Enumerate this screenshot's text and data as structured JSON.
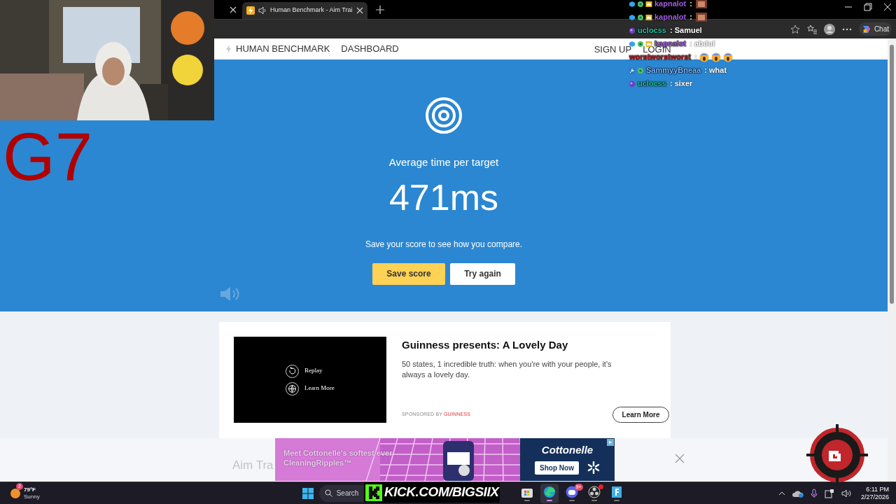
{
  "browser": {
    "tabs": [
      {
        "title": "Human Benchmark - Aim Trai",
        "selected": true,
        "audio": true
      }
    ],
    "chat_button": "Chat"
  },
  "site_nav": {
    "brand": "HUMAN BENCHMARK",
    "links": [
      "DASHBOARD"
    ],
    "account": [
      "SIGN UP",
      "LOGIN"
    ]
  },
  "result": {
    "label": "Average time per target",
    "value": "471ms",
    "prompt": "Save your score to see how you compare.",
    "buttons": [
      {
        "label": "Save score",
        "kind": "primary"
      },
      {
        "label": "Try again",
        "kind": "secondary"
      }
    ]
  },
  "ad_card": {
    "video_actions": [
      "Replay",
      "Learn More"
    ],
    "title": "Guinness presents: A Lovely Day",
    "description": "50 states, 1 incredible truth: when you're with your people, it's always a lovely day.",
    "sponsor_label": "SPONSORED BY",
    "sponsor": "GUINNESS",
    "button": "Learn More"
  },
  "section_heading": "Aim Tra",
  "banner_ad": {
    "tagline": "Meet Cottonelle's softest ever CleaningRipples™",
    "brand": "Cottonelle",
    "button": "Shop Now"
  },
  "stream_overlay": {
    "tag": "G7",
    "banner": "KICK.COM/BIGSIIX"
  },
  "chat": [
    {
      "user": "kapnalot",
      "color": "#a05ce0",
      "kind": "subemote",
      "message": ":"
    },
    {
      "user": "kapnalot",
      "color": "#a05ce0",
      "kind": "subemote",
      "message": ":"
    },
    {
      "user": "uclocss",
      "color": "#22c7a0",
      "kind": "vip",
      "message": ": Samuel"
    },
    {
      "user": "kapnalot",
      "color": "#a05ce0",
      "kind": "sub",
      "message": ": abdul"
    },
    {
      "user": "worstworstworst",
      "color": "#b3202c",
      "kind": "reactor",
      "message": ":"
    },
    {
      "user": "SammyyBneaa",
      "color": "#7cb6ff",
      "kind": "mod",
      "message": ": what"
    },
    {
      "user": "uclocss",
      "color": "#22c7a0",
      "kind": "vip",
      "message": ": sixer"
    }
  ],
  "taskbar": {
    "weather": {
      "temp": "79°F",
      "condition": "Sunny",
      "badge": "2"
    },
    "search": "Search",
    "apps": [
      {
        "kind": "store",
        "active": false
      },
      {
        "kind": "edge",
        "active": true
      },
      {
        "kind": "discord",
        "active": false,
        "badge": "9+"
      },
      {
        "kind": "obs",
        "active": false,
        "alert": true
      },
      {
        "kind": "app",
        "active": false
      }
    ],
    "time": "6:11 PM",
    "date": "2/27/2026"
  }
}
